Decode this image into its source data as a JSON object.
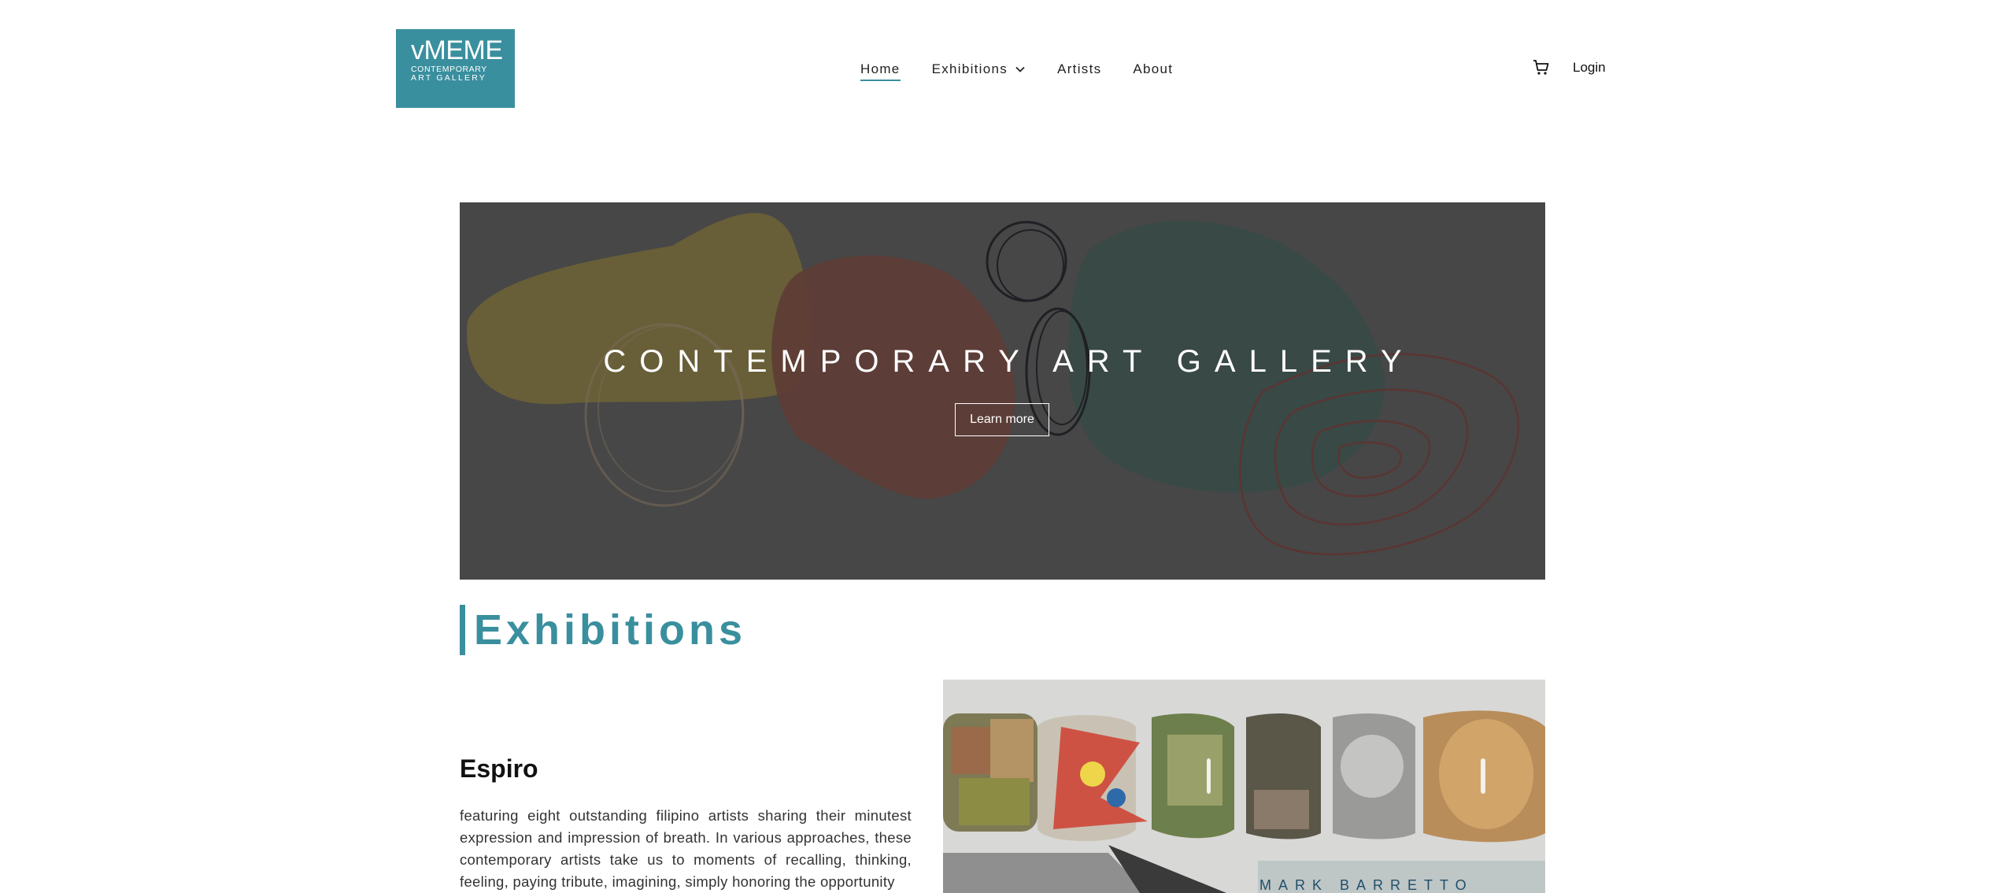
{
  "header": {
    "logo": {
      "brand": "vMEME",
      "line1": "CONTEMPORARY",
      "line2": "ART GALLERY",
      "color": "#3a8f9e"
    },
    "nav": [
      {
        "label": "Home",
        "active": true
      },
      {
        "label": "Exhibitions",
        "has_dropdown": true
      },
      {
        "label": "Artists"
      },
      {
        "label": "About"
      }
    ],
    "cart_icon": "cart-icon",
    "login_label": "Login"
  },
  "hero": {
    "title": "CONTEMPORARY ART GALLERY",
    "button_label": "Learn more"
  },
  "exhibitions": {
    "heading": "Exhibitions",
    "accent_color": "#3a8f9e",
    "items": [
      {
        "title": "Espiro",
        "description": "featuring eight outstanding filipino artists sharing their minutest expression and impression of breath. In various approaches, these contemporary artists take us to moments of recalling, thinking, feeling, paying tribute, imagining, simply honoring the opportunity",
        "image_caption": "MARK BARRETTO"
      }
    ]
  }
}
